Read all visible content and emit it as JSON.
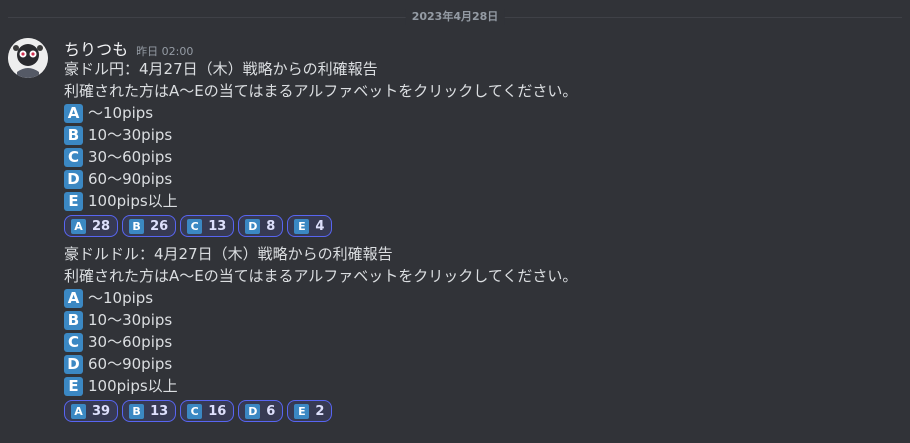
{
  "divider": {
    "date": "2023年4月28日"
  },
  "message": {
    "username": "ちりつも",
    "timestamp": "昨日 02:00",
    "posts": [
      {
        "title": "豪ドル円：4月27日（木）戦略からの利確報告",
        "instruction": "利確された方はA～Eの当てはまるアルファベットをクリックしてください。",
        "options": [
          {
            "letter": "A",
            "text": "～10pips"
          },
          {
            "letter": "B",
            "text": "10～30pips"
          },
          {
            "letter": "C",
            "text": "30～60pips"
          },
          {
            "letter": "D",
            "text": "60～90pips"
          },
          {
            "letter": "E",
            "text": "100pips以上"
          }
        ],
        "reactions": [
          {
            "letter": "A",
            "count": "28"
          },
          {
            "letter": "B",
            "count": "26"
          },
          {
            "letter": "C",
            "count": "13"
          },
          {
            "letter": "D",
            "count": "8"
          },
          {
            "letter": "E",
            "count": "4"
          }
        ]
      },
      {
        "title": "豪ドルドル：4月27日（木）戦略からの利確報告",
        "instruction": "利確された方はA～Eの当てはまるアルファベットをクリックしてください。",
        "options": [
          {
            "letter": "A",
            "text": "～10pips"
          },
          {
            "letter": "B",
            "text": "10～30pips"
          },
          {
            "letter": "C",
            "text": "30～60pips"
          },
          {
            "letter": "D",
            "text": "60～90pips"
          },
          {
            "letter": "E",
            "text": "100pips以上"
          }
        ],
        "reactions": [
          {
            "letter": "A",
            "count": "39"
          },
          {
            "letter": "B",
            "count": "13"
          },
          {
            "letter": "C",
            "count": "16"
          },
          {
            "letter": "D",
            "count": "6"
          },
          {
            "letter": "E",
            "count": "2"
          }
        ]
      }
    ]
  },
  "colors": {
    "background": "#313338",
    "emoji_blue": "#3b88c3",
    "reaction_border": "#5865f2",
    "reaction_bg": "#373a53"
  }
}
